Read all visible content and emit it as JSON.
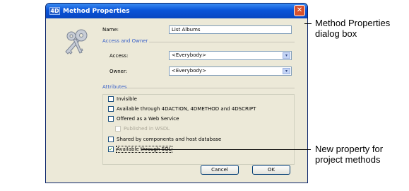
{
  "window": {
    "app_icon_text": "4D",
    "title": "Method Properties",
    "close_glyph": "✕"
  },
  "form": {
    "name_label": "Name:",
    "name_value": "List Albums",
    "access_section": "Access and Owner",
    "access_label": "Access:",
    "access_value": "<Everybody>",
    "owner_label": "Owner:",
    "owner_value": "<Everybody>",
    "attributes_section": "Attributes",
    "attributes": [
      {
        "label": "Invisible",
        "checked": false,
        "enabled": true
      },
      {
        "label": "Available through 4DACTION, 4DMETHOD and 4DSCRIPT",
        "checked": false,
        "enabled": true
      },
      {
        "label": "Offered as a Web Service",
        "checked": false,
        "enabled": true
      },
      {
        "label": "Published in WSDL",
        "checked": false,
        "enabled": false
      },
      {
        "label": "Shared by components and host database",
        "checked": false,
        "enabled": true
      },
      {
        "label": "Available through SQL",
        "checked": true,
        "enabled": true
      }
    ],
    "cancel_label": "Cancel",
    "ok_label": "OK",
    "dropdown_arrow": "▾",
    "check_glyph": "✓"
  },
  "callouts": {
    "dialog_line1": "Method Properties",
    "dialog_line2": "dialog box",
    "property_line1": "New property for",
    "property_line2": "project methods"
  },
  "icons": [
    "keys-icon",
    "close-icon",
    "dropdown-arrow-icon",
    "checkmark-icon"
  ]
}
